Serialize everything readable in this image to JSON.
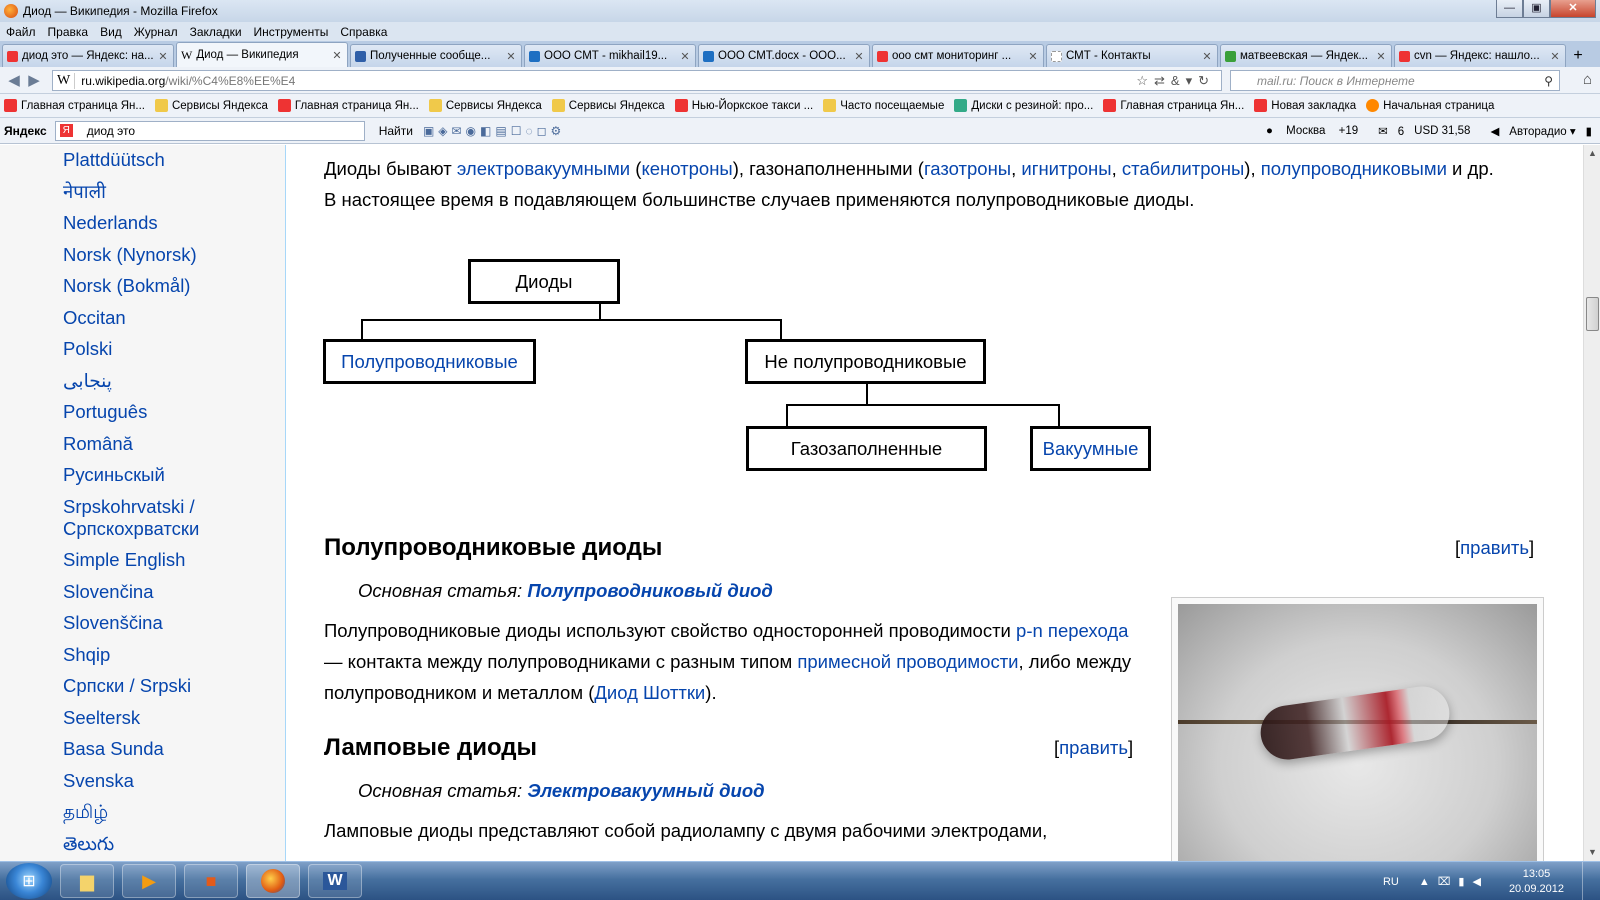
{
  "window": {
    "title": "Диод — Википедия - Mozilla Firefox"
  },
  "menu": [
    "Файл",
    "Правка",
    "Вид",
    "Журнал",
    "Закладки",
    "Инструменты",
    "Справка"
  ],
  "tabs": [
    {
      "label": "диод это — Яндекс: на...",
      "icon_color": "#e33"
    },
    {
      "label": "Диод — Википедия",
      "icon_color": "#ffffff"
    },
    {
      "label": "Полученные сообще...",
      "icon_color": "#2f5fa8"
    },
    {
      "label": "ООО СМТ - mikhail19...",
      "icon_color": "#1e6fc2"
    },
    {
      "label": "ООО СМТ.docx - ООО...",
      "icon_color": "#1e6fc2"
    },
    {
      "label": "ооо смт мониторинг ...",
      "icon_color": "#e33"
    },
    {
      "label": "СМТ - Контакты",
      "icon_color": "#ddd"
    },
    {
      "label": "матвеевская — Яндек...",
      "icon_color": "#3aa03a"
    },
    {
      "label": "cvn — Яндекс: нашло...",
      "icon_color": "#e33"
    }
  ],
  "nav": {
    "url_host": "ru.wikipedia.org",
    "url_path": "/wiki/%C4%E8%EE%E4",
    "search_placeholder": "mail.ru: Поиск в Интернете"
  },
  "bookmarks": [
    {
      "label": "Главная страница Ян...",
      "icon": "yandex-icon"
    },
    {
      "label": "Сервисы Яндекса",
      "icon": "folder-icon"
    },
    {
      "label": "Главная страница Ян...",
      "icon": "yandex-icon"
    },
    {
      "label": "Сервисы Яндекса",
      "icon": "folder-icon"
    },
    {
      "label": "Сервисы Яндекса",
      "icon": "folder-icon"
    },
    {
      "label": "Нью-Йоркское такси ...",
      "icon": "yandex-icon"
    },
    {
      "label": "Часто посещаемые",
      "icon": "folder-icon"
    },
    {
      "label": "Диски с резиной: про...",
      "icon": "yandex-icon"
    },
    {
      "label": "Главная страница Ян...",
      "icon": "yandex-icon"
    },
    {
      "label": "Новая закладка",
      "icon": "yandex-icon"
    },
    {
      "label": "Начальная страница",
      "icon": "yandex-icon"
    }
  ],
  "yandex_bar": {
    "brand": "Яндекс",
    "query": "диод это",
    "find": "Найти",
    "city": "Москва",
    "temp": "+19",
    "mail": "6",
    "usd": "USD 31,58",
    "auto": "Авторадио"
  },
  "sidebar_langs": [
    "Plattdüütsch",
    "नेपाली",
    "Nederlands",
    "Norsk (Nynorsk)",
    "Norsk (Bokmål)",
    "Occitan",
    "Polski",
    "پنجابی",
    "Português",
    "Română",
    "Русиньскый",
    "Srpskohrvatski / Српскохрватски",
    "Simple English",
    "Slovenčina",
    "Slovenščina",
    "Shqip",
    "Српски / Srpski",
    "Seeltersk",
    "Basa Sunda",
    "Svenska",
    "தமிழ்",
    "తెలుగు"
  ],
  "article": {
    "intro": {
      "t1": "Диоды бывают ",
      "l1": "электровакуумными",
      "t2": " (",
      "l2": "кенотроны",
      "t3": "), газонаполненными (",
      "l3": "газотроны",
      "t4": ", ",
      "l4": "игнитроны",
      "t5": ", ",
      "l5": "стабилитроны",
      "t6": "), ",
      "l6": "полупроводниковыми",
      "t7": " и др. В настоящее время в подавляющем большинстве случаев применяются полупроводниковые диоды."
    },
    "diagram": {
      "root": "Диоды",
      "semi": "Полупроводниковые",
      "nonsemi": "Не полупроводниковые",
      "gas": "Газозаполненные",
      "vac": "Вакуумные"
    },
    "s1": {
      "heading": "Полупроводниковые диоды",
      "edit_open": "[",
      "edit": "править",
      "edit_close": "]",
      "hat_prefix": "Основная статья: ",
      "hat_link": "Полупроводниковый диод",
      "p_t1": "Полупроводниковые диоды используют свойство односторонней проводимости ",
      "p_l1": "p-n перехода",
      "p_t2": " — контакта между полупроводниками с разным типом ",
      "p_l2": "примесной проводимости",
      "p_t3": ", либо между полупроводником и металлом (",
      "p_l3": "Диод Шоттки",
      "p_t4": ")."
    },
    "s2": {
      "heading": "Ламповые диоды",
      "edit_open": "[",
      "edit": "править",
      "edit_close": "]",
      "hat_prefix": "Основная статья: ",
      "hat_link": "Электровакуумный диод",
      "p": "Ламповые диоды представляют собой радиолампу с двумя рабочими электродами,"
    }
  },
  "taskbar": {
    "lang": "RU",
    "time": "13:05",
    "date": "20.09.2012"
  }
}
